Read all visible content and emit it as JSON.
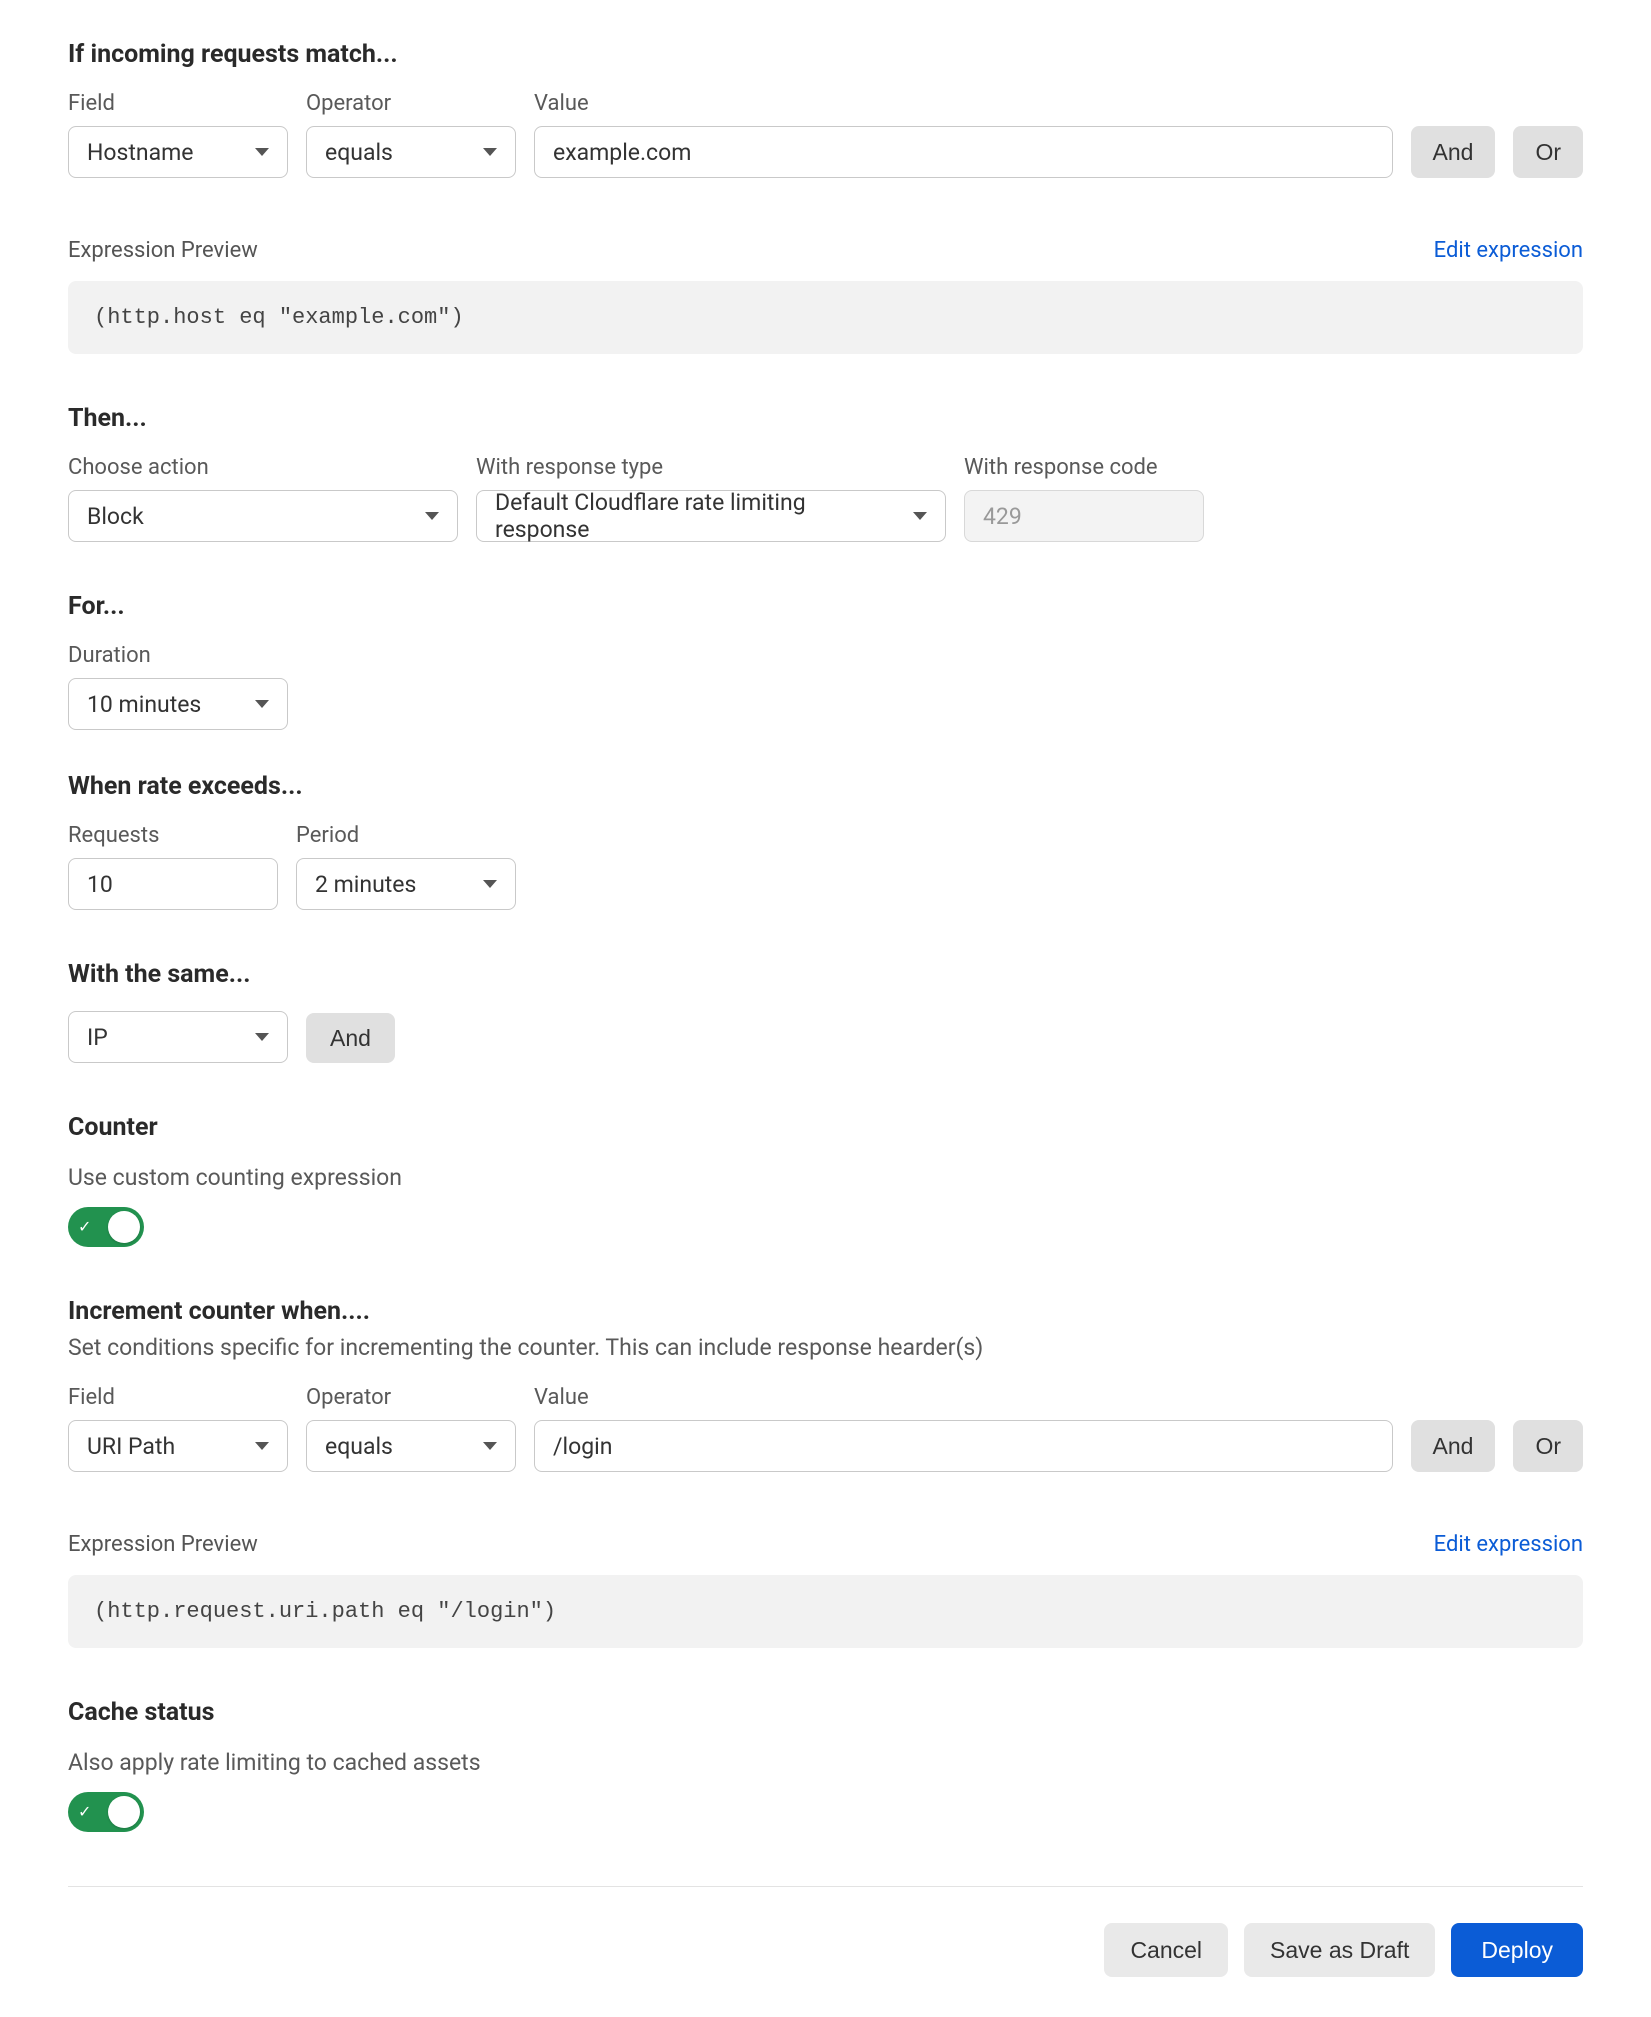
{
  "match": {
    "heading": "If incoming requests match...",
    "fieldLabel": "Field",
    "operatorLabel": "Operator",
    "valueLabel": "Value",
    "fieldValue": "Hostname",
    "operatorValue": "equals",
    "valueValue": "example.com",
    "andLabel": "And",
    "orLabel": "Or"
  },
  "expr1": {
    "title": "Expression Preview",
    "editLink": "Edit expression",
    "code": "(http.host eq \"example.com\")"
  },
  "then": {
    "heading": "Then...",
    "chooseActionLabel": "Choose action",
    "chooseActionValue": "Block",
    "respTypeLabel": "With response type",
    "respTypeValue": "Default Cloudflare rate limiting response",
    "respCodeLabel": "With response code",
    "respCodePlaceholder": "429"
  },
  "forSection": {
    "heading": "For...",
    "durationLabel": "Duration",
    "durationValue": "10 minutes"
  },
  "rate": {
    "heading": "When rate exceeds...",
    "requestsLabel": "Requests",
    "requestsValue": "10",
    "periodLabel": "Period",
    "periodValue": "2 minutes"
  },
  "same": {
    "heading": "With the same...",
    "ipValue": "IP",
    "andLabel": "And"
  },
  "counter": {
    "heading": "Counter",
    "subtext": "Use custom counting expression"
  },
  "increment": {
    "heading": "Increment counter when....",
    "subtext": "Set conditions specific for incrementing the counter. This can include response hearder(s)",
    "fieldLabel": "Field",
    "operatorLabel": "Operator",
    "valueLabel": "Value",
    "fieldValue": "URI Path",
    "operatorValue": "equals",
    "valueValue": "/login",
    "andLabel": "And",
    "orLabel": "Or"
  },
  "expr2": {
    "title": "Expression Preview",
    "editLink": "Edit expression",
    "code": "(http.request.uri.path eq \"/login\")"
  },
  "cache": {
    "heading": "Cache status",
    "subtext": "Also apply rate limiting to cached assets"
  },
  "footer": {
    "cancel": "Cancel",
    "draft": "Save as Draft",
    "deploy": "Deploy"
  }
}
